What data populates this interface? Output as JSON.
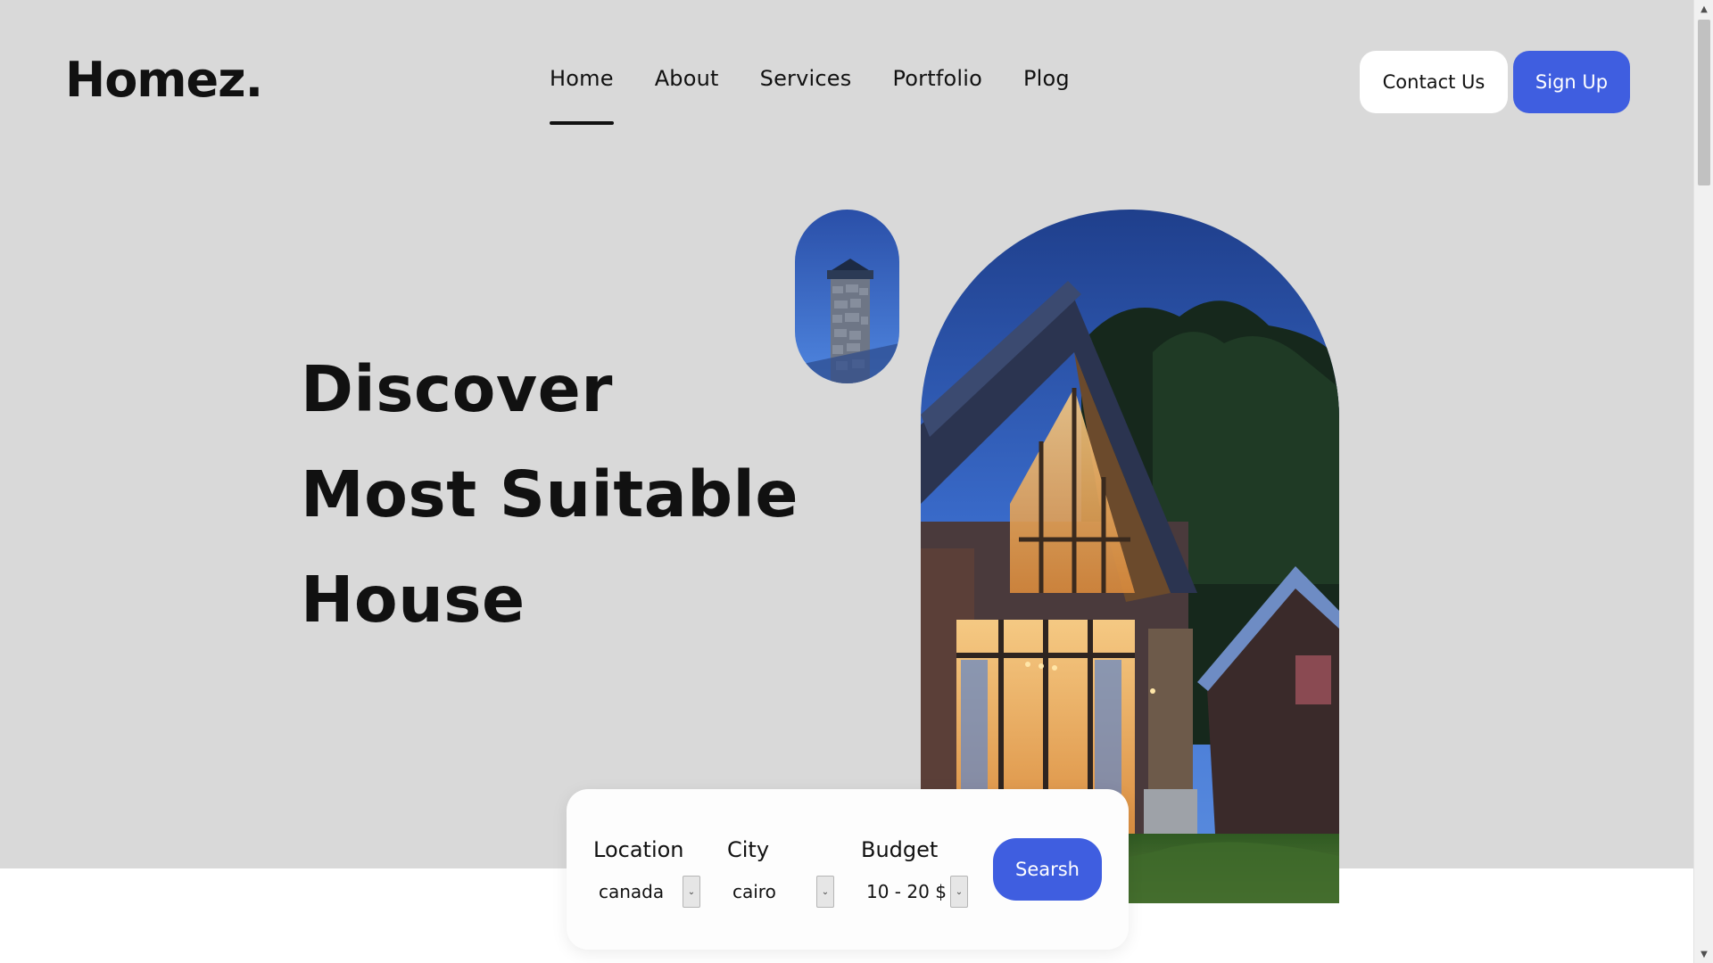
{
  "brand": {
    "logo": "Homez."
  },
  "nav": {
    "items": [
      {
        "label": "Home",
        "active": true
      },
      {
        "label": "About",
        "active": false
      },
      {
        "label": "Services",
        "active": false
      },
      {
        "label": "Portfolio",
        "active": false
      },
      {
        "label": "Plog",
        "active": false
      }
    ]
  },
  "header_actions": {
    "contact_label": "Contact Us",
    "signup_label": "Sign Up"
  },
  "hero": {
    "headline": [
      "Discover",
      "Most Suitable",
      "House"
    ]
  },
  "search": {
    "location": {
      "label": "Location",
      "value": "canada"
    },
    "city": {
      "label": "City",
      "value": "cairo"
    },
    "budget": {
      "label": "Budget",
      "value": "10 - 20 $"
    },
    "button_label": "Searsh"
  },
  "colors": {
    "accent": "#3f5ee0",
    "hero_background": "#d9d9d9",
    "page_background": "#ffffff"
  },
  "icons": {
    "select_arrow": "chevron-down-icon",
    "scroll_up": "triangle-up-icon",
    "scroll_down": "triangle-down-icon"
  }
}
